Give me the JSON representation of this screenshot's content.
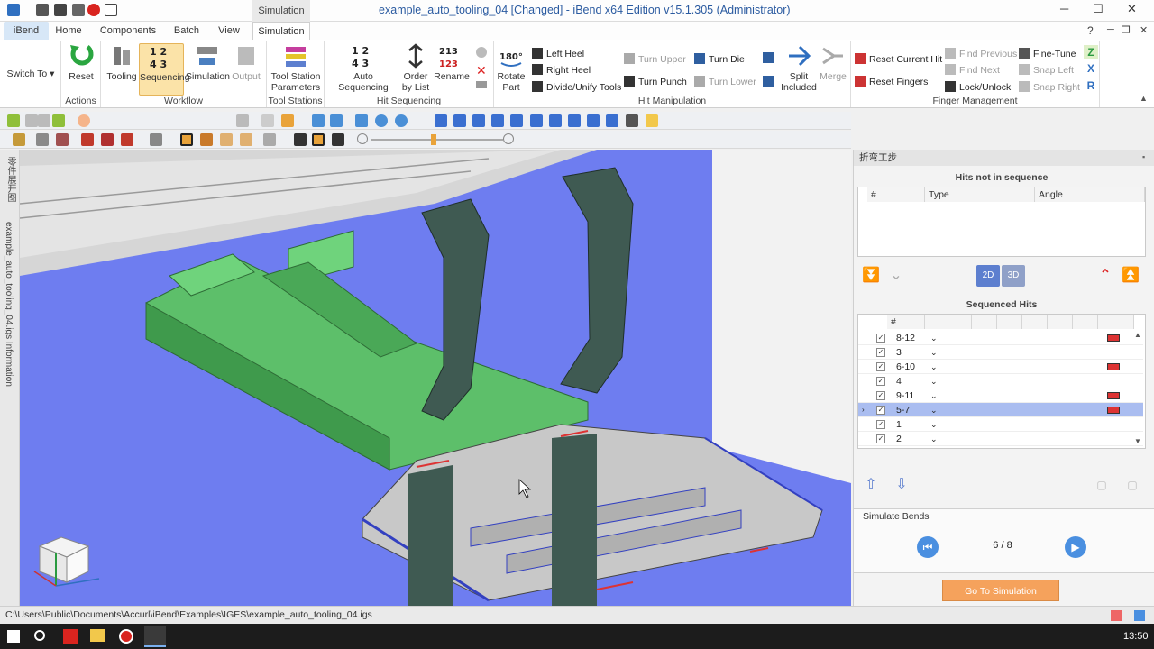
{
  "window": {
    "title": "example_auto_tooling_04 [Changed] - iBend x64 Edition v15.1.305 (Administrator)",
    "context_tab_label": "Simulation"
  },
  "ribbon_tabs": [
    "iBend",
    "Home",
    "Components",
    "Batch",
    "View",
    "Simulation"
  ],
  "ribbon": {
    "switch_to": "Switch To",
    "actions": {
      "label": "Actions",
      "reset": "Reset"
    },
    "workflow": {
      "label": "Workflow",
      "tooling": "Tooling",
      "sequencing": "Sequencing",
      "simulation": "Simulation",
      "output": "Output"
    },
    "tool_stations": {
      "label": "Tool Stations",
      "params": "Tool Station Parameters"
    },
    "hit_sequencing": {
      "label": "Hit Sequencing",
      "auto": "Auto Sequencing",
      "order": "Order by List",
      "rename": "Rename"
    },
    "hit_manipulation": {
      "label": "Hit Manipulation",
      "rotate": "Rotate Part",
      "left_heel": "Left Heel",
      "right_heel": "Right Heel",
      "divide": "Divide/Unify Tools",
      "turn_upper": "Turn Upper",
      "turn_punch": "Turn Punch",
      "turn_die": "Turn Die",
      "turn_lower": "Turn Lower",
      "split": "Split Included",
      "merge": "Merge"
    },
    "finger_management": {
      "label": "Finger Management",
      "reset_current": "Reset Current Hit",
      "reset_fingers": "Reset Fingers",
      "find_previous": "Find Previous",
      "find_next": "Find Next",
      "lock": "Lock/Unlock",
      "fine_tune": "Fine-Tune",
      "snap_left": "Snap Left",
      "snap_right": "Snap Right"
    }
  },
  "left_strip": {
    "tab1": "零件展开图",
    "tab2": "example_auto_tooling_04.igs Information"
  },
  "right_panel": {
    "header": "折弯工步",
    "hits_not_in_sequence": {
      "title": "Hits not in sequence",
      "columns": [
        "#",
        "Type",
        "Angle"
      ]
    },
    "sequenced_hits": {
      "title": "Sequenced Hits",
      "column_hash": "#",
      "rows": [
        {
          "id": "8-12",
          "checked": "✓",
          "red": true
        },
        {
          "id": "3",
          "checked": "✓",
          "red": false
        },
        {
          "id": "6-10",
          "checked": "✓",
          "red": true
        },
        {
          "id": "4",
          "checked": "✓",
          "red": false
        },
        {
          "id": "9-11",
          "checked": "✓",
          "red": true
        },
        {
          "id": "5-7",
          "checked": "✓",
          "red": true,
          "selected": true
        },
        {
          "id": "1",
          "checked": "✓",
          "red": false
        },
        {
          "id": "2",
          "checked": "✓",
          "red": false
        }
      ]
    },
    "simulate_bends": {
      "title": "Simulate Bends",
      "counter": "6 / 8",
      "go_button": "Go To Simulation"
    }
  },
  "status": {
    "path": "C:\\Users\\Public\\Documents\\Accurl\\iBend\\Examples\\IGES\\example_auto_tooling_04.igs"
  },
  "taskbar": {
    "clock": "13:50"
  },
  "colors": {
    "viewport_bg": "#6e7df0",
    "part_green": "#5dbf6a",
    "tool_dark": "#3f5a52",
    "sheet_grey": "#c8c8c8",
    "selected_row": "#aabdf0",
    "accent_orange": "#f5a25c"
  }
}
